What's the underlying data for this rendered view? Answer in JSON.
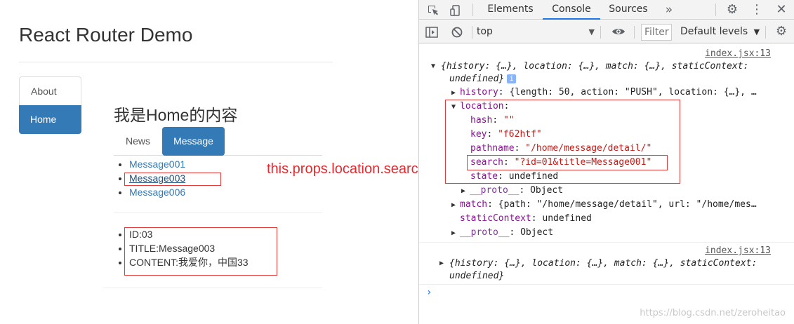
{
  "app": {
    "title": "React Router Demo",
    "nav": [
      {
        "label": "About",
        "active": false
      },
      {
        "label": "Home",
        "active": true
      }
    ],
    "home_heading": "我是Home的内容",
    "tabs": [
      {
        "label": "News",
        "active": false
      },
      {
        "label": "Message",
        "active": true
      }
    ],
    "messages": [
      "Message001",
      "Message003",
      "Message006"
    ],
    "selected_message": "Message003",
    "detail": [
      "ID:03",
      "TITLE:Message003",
      "CONTENT:我爱你，中国33"
    ],
    "annotation": "this.props.location.search",
    "colors": {
      "primary": "#337ab7",
      "highlight_box": "#e23c3c",
      "annotation_text": "#e8282e"
    }
  },
  "devtools": {
    "tabs": [
      "Elements",
      "Console",
      "Sources"
    ],
    "active_tab": "Console",
    "more_tabs_icon": "double-chevron-right-icon",
    "context": "top",
    "filter_placeholder": "Filter",
    "levels": "Default levels",
    "entries": [
      {
        "source": "index.jsx:13",
        "summary_line1": "{history: {…}, location: {…}, match: {…}, staticContext:",
        "summary_line2": "undefined}",
        "info_icon": "i",
        "history_key": "history",
        "history_value": "{length: 50, action: \"PUSH\", location: {…}, …",
        "location_key": "location",
        "location_props": [
          {
            "key": "hash",
            "value": "\"\""
          },
          {
            "key": "key",
            "value": "\"f62htf\""
          },
          {
            "key": "pathname",
            "value": "\"/home/message/detail/\""
          },
          {
            "key": "search",
            "value": "\"?id=01&title=Message001\""
          },
          {
            "key": "state",
            "value": "undefined"
          }
        ],
        "proto_key": "__proto__",
        "proto_value": "Object",
        "match_key": "match",
        "match_value": "{path: \"/home/message/detail\", url: \"/home/mes…",
        "static_key": "staticContext",
        "static_value": "undefined"
      },
      {
        "source": "index.jsx:13",
        "summary_line1": "{history: {…}, location: {…}, match: {…}, staticContext:",
        "summary_line2": "undefined}"
      }
    ],
    "prompt": "›",
    "watermark": "https://blog.csdn.net/zeroheitao"
  }
}
